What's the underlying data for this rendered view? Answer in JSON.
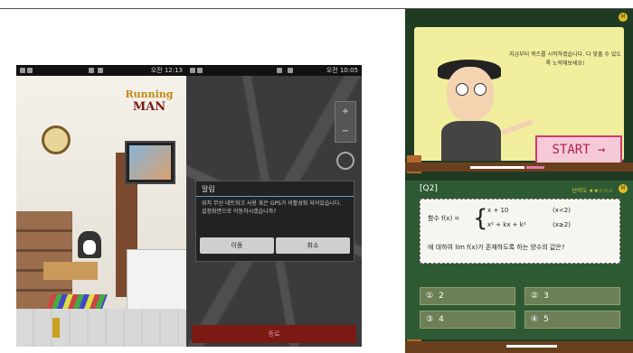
{
  "phone1": {
    "status_time": "오전 12:13",
    "logo_line1": "Running",
    "logo_line2": "MAN"
  },
  "phone2": {
    "status_time": "오전 10:05",
    "zoom_in": "+",
    "zoom_out": "−",
    "dialog": {
      "title": "알림",
      "message": "위치 무선 네트워크 사용 혹은 GPS가 비활성화 되어있습니다. 설정화면으로 이동하시겠습니까?",
      "btn_ok": "이동",
      "btn_cancel": "취소"
    },
    "bottom_button": "종료"
  },
  "quiz": {
    "intro_text": "지금부터 퀴즈를 시작하겠습니다. 다 맞출 수 있도록 노력해보세요!",
    "start_label": "START →",
    "badge": "M",
    "question_label": "[Q2]",
    "difficulty": "난이도 ★★☆☆☆",
    "eq_left": "함수 f(x) =",
    "case1_expr": "x + 10",
    "case1_cond": "(x<2)",
    "case2_expr": "x² + kx + k²",
    "case2_cond": "(x≥2)",
    "question_text": "에 대하여 lim f(x)가 존재하도록 하는 양수의 값은?",
    "options": [
      {
        "num": "①",
        "value": "2"
      },
      {
        "num": "②",
        "value": "3"
      },
      {
        "num": "③",
        "value": "4"
      },
      {
        "num": "④",
        "value": "5"
      }
    ]
  }
}
